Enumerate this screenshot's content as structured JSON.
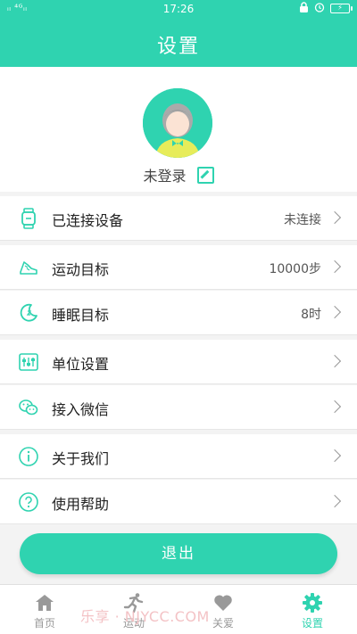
{
  "status_bar": {
    "left": "ᵢₗ ⁴ᴳᵢₗ",
    "time": "17:26",
    "battery": "⚡"
  },
  "header": {
    "title": "设置"
  },
  "profile": {
    "login_text": "未登录"
  },
  "menu": [
    {
      "label": "已连接设备",
      "value": "未连接",
      "icon": "watch-icon"
    },
    {
      "label": "运动目标",
      "value": "10000步",
      "icon": "shoe-icon"
    },
    {
      "label": "睡眠目标",
      "value": "8时",
      "icon": "moon-icon"
    },
    {
      "label": "单位设置",
      "value": "",
      "icon": "sliders-icon"
    },
    {
      "label": "接入微信",
      "value": "",
      "icon": "wechat-icon"
    },
    {
      "label": "关于我们",
      "value": "",
      "icon": "info-icon"
    },
    {
      "label": "使用帮助",
      "value": "",
      "icon": "help-icon"
    }
  ],
  "logout_label": "退出",
  "tabs": [
    {
      "label": "首页",
      "icon": "home-icon",
      "active": false
    },
    {
      "label": "运动",
      "icon": "running-icon",
      "active": false
    },
    {
      "label": "关爱",
      "icon": "heart-icon",
      "active": false
    },
    {
      "label": "设置",
      "icon": "gear-icon",
      "active": true
    }
  ],
  "watermark": "乐享 · NJYCC.COM",
  "colors": {
    "accent": "#2fd3b0",
    "background": "#f3f3f3",
    "inactive_tab": "#999999"
  }
}
